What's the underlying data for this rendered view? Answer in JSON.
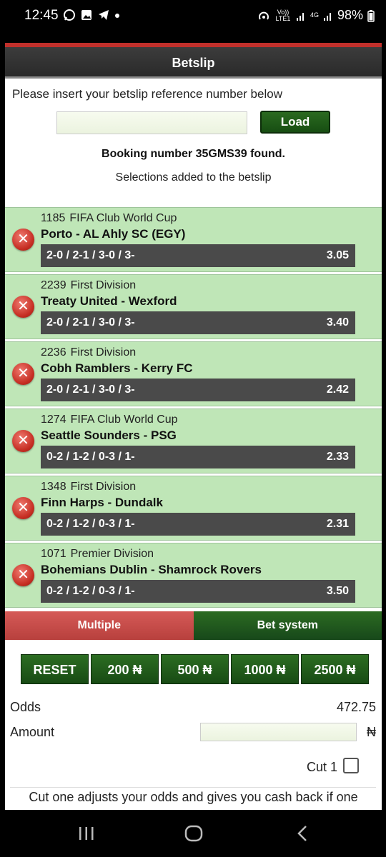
{
  "status_bar": {
    "time": "12:45",
    "left_icons": [
      "whatsapp-icon",
      "gallery-icon",
      "telegram-icon",
      "dot-icon"
    ],
    "volte": "Vo)) LTE1",
    "network": "4G",
    "battery": "98%"
  },
  "header": {
    "title": "Betslip"
  },
  "betslip": {
    "instruction": "Please insert your betslip reference number below",
    "reference_value": "",
    "load_label": "Load",
    "found_message": "Booking number 35GMS39 found.",
    "added_message": "Selections added to the betslip"
  },
  "selections": [
    {
      "code": "1185",
      "league": "FIFA Club World Cup",
      "match": "Porto - AL Ahly SC (EGY)",
      "pick": "2-0 / 2-1 / 3-0 / 3-",
      "odds": "3.05"
    },
    {
      "code": "2239",
      "league": "First Division",
      "match": "Treaty United - Wexford",
      "pick": "2-0 / 2-1 / 3-0 / 3-",
      "odds": "3.40"
    },
    {
      "code": "2236",
      "league": "First Division",
      "match": "Cobh Ramblers - Kerry FC",
      "pick": "2-0 / 2-1 / 3-0 / 3-",
      "odds": "2.42"
    },
    {
      "code": "1274",
      "league": "FIFA Club World Cup",
      "match": "Seattle Sounders - PSG",
      "pick": "0-2 / 1-2 / 0-3 / 1-",
      "odds": "2.33"
    },
    {
      "code": "1348",
      "league": "First Division",
      "match": "Finn Harps - Dundalk",
      "pick": "0-2 / 1-2 / 0-3 / 1-",
      "odds": "2.31"
    },
    {
      "code": "1071",
      "league": "Premier Division",
      "match": "Bohemians Dublin - Shamrock Rovers",
      "pick": "0-2 / 1-2 / 0-3 / 1-",
      "odds": "3.50"
    }
  ],
  "remove_glyph": "✕",
  "tabs": {
    "multiple": "Multiple",
    "system": "Bet system"
  },
  "stakes": {
    "reset": "RESET",
    "s200": "200 ₦",
    "s500": "500 ₦",
    "s1000": "1000 ₦",
    "s2500": "2500 ₦"
  },
  "summary": {
    "odds_label": "Odds",
    "odds_value": "472.75",
    "amount_label": "Amount",
    "amount_value": "",
    "currency": "₦",
    "cut_label": "Cut 1",
    "cut_info": "Cut one adjusts your odds and gives you cash back if one"
  },
  "colors": {
    "accent_red": "#c0302b",
    "selection_bg": "#bfe6b7",
    "button_green": "#1e5c18",
    "pick_bar": "#4a4a4a"
  }
}
